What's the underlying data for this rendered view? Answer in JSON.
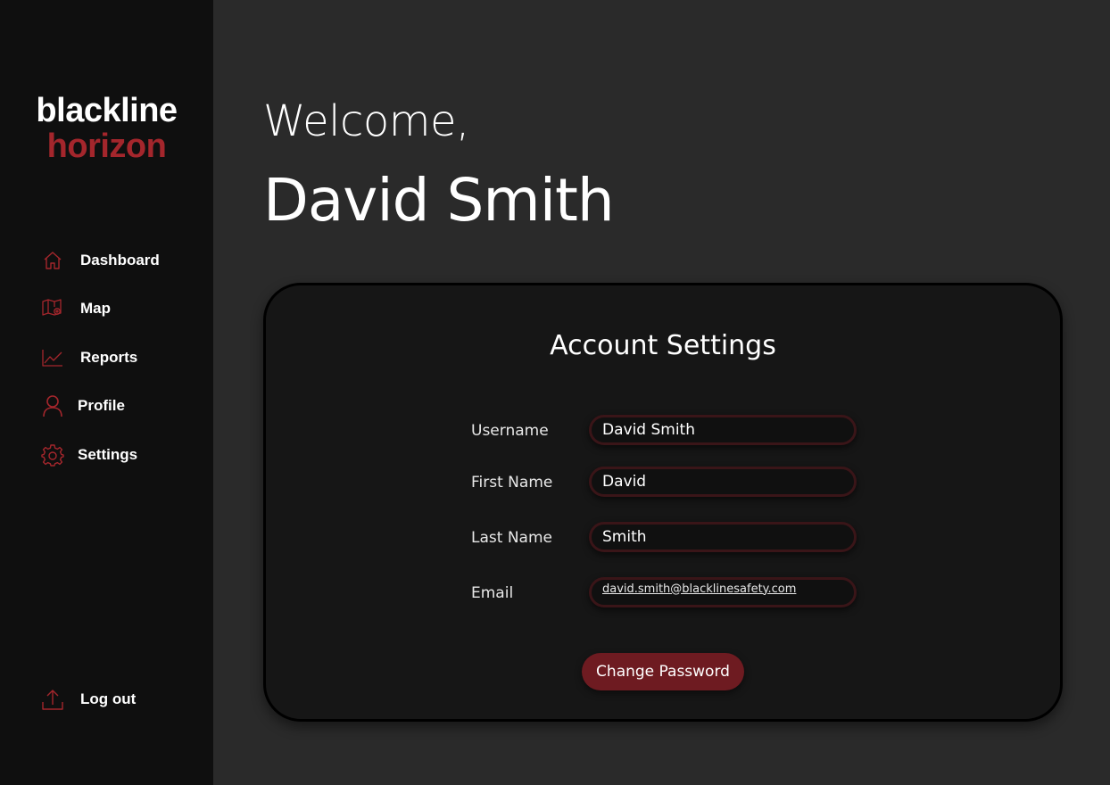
{
  "brand": {
    "line1": "blackline",
    "line2": "horizon",
    "accent_color": "#a4262c"
  },
  "sidebar": {
    "items": [
      {
        "label": "Dashboard",
        "icon": "home-icon"
      },
      {
        "label": "Map",
        "icon": "map-icon"
      },
      {
        "label": "Reports",
        "icon": "chart-icon"
      },
      {
        "label": "Profile",
        "icon": "user-icon"
      },
      {
        "label": "Settings",
        "icon": "gear-icon"
      }
    ],
    "logout": {
      "label": "Log out",
      "icon": "logout-icon"
    }
  },
  "main": {
    "greeting": "Welcome,",
    "user_name": "David Smith"
  },
  "account_settings": {
    "title": "Account Settings",
    "fields": {
      "username": {
        "label": "Username",
        "value": "David Smith"
      },
      "first_name": {
        "label": "First Name",
        "value": "David"
      },
      "last_name": {
        "label": "Last Name",
        "value": "Smith"
      },
      "email": {
        "label": "Email",
        "value": "david.smith@blacklinesafety.com"
      }
    },
    "change_password_label": "Change Password",
    "button_color": "#6e1b21"
  }
}
